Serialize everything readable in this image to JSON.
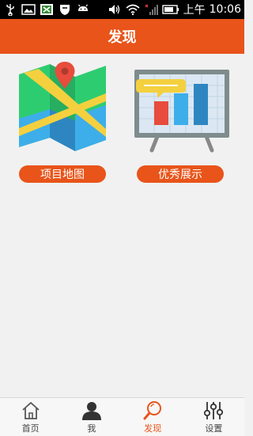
{
  "status_bar": {
    "time": "10:06",
    "time_prefix": "上午",
    "icons": [
      "usb-icon",
      "image-icon",
      "app-icon",
      "shield-icon",
      "android-icon",
      "volume-icon",
      "wifi-icon",
      "signal-icon",
      "battery-icon"
    ]
  },
  "header": {
    "title": "发现"
  },
  "features": [
    {
      "icon": "map-icon",
      "label": "项目地图"
    },
    {
      "icon": "presentation-icon",
      "label": "优秀展示"
    }
  ],
  "tabbar": {
    "items": [
      {
        "icon": "home-icon",
        "label": "首页",
        "active": false
      },
      {
        "icon": "user-icon",
        "label": "我",
        "active": false
      },
      {
        "icon": "search-icon",
        "label": "发现",
        "active": true
      },
      {
        "icon": "settings-icon",
        "label": "设置",
        "active": false
      }
    ]
  },
  "colors": {
    "accent": "#e8541a",
    "tab_inactive": "#444444"
  }
}
